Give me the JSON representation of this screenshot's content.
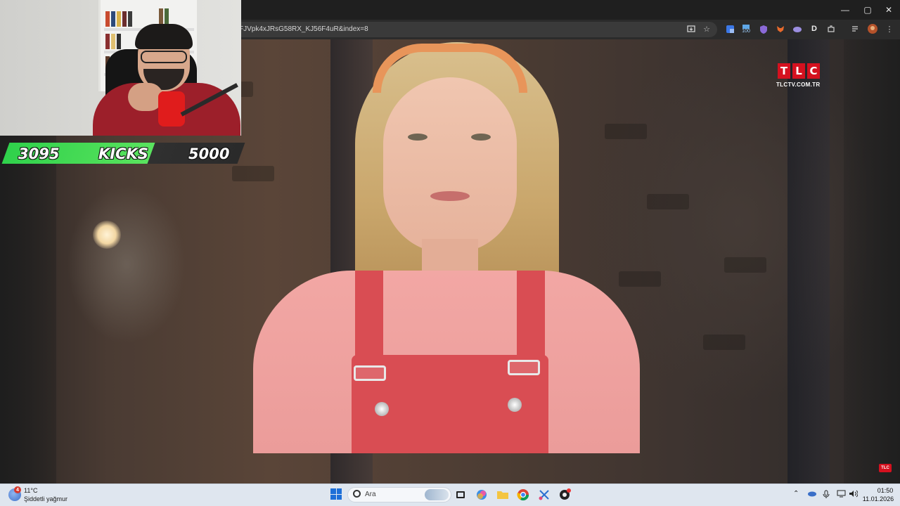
{
  "browser": {
    "url": "FJVpk4xJRsG58RX_KJ56F4uR&index=8",
    "window_controls": {
      "minimize": "—",
      "maximize": "▢",
      "close": "✕"
    },
    "toolbar_icons": [
      "install-icon",
      "bookmark-star-icon",
      "translate-icon",
      "extension-100-icon",
      "shield-extension-icon",
      "fox-extension-icon",
      "cloud-extension-icon",
      "d-extension-icon",
      "puzzle-extensions-icon",
      "media-controls-icon",
      "profile-avatar-icon",
      "menu-icon"
    ],
    "extension_badge": "100",
    "extension_d": "D"
  },
  "video": {
    "channel_logo": [
      "T",
      "L",
      "C"
    ],
    "channel_url": "TLCTV.COM.TR",
    "watermark": "TLC"
  },
  "stream_overlay": {
    "current_count": "3095",
    "label": "KICKS",
    "goal": "5000",
    "progress_fraction": 0.619,
    "colors": {
      "progress": "#2fd14b",
      "background": "#2d2d2d"
    }
  },
  "taskbar": {
    "weather_badge": "4",
    "temperature": "11°C",
    "weather_desc": "Şiddetli yağmur",
    "search_placeholder": "Ara",
    "clock_time": "01:50",
    "clock_date": "11.01.2026",
    "accent": "#1d6fd8"
  }
}
